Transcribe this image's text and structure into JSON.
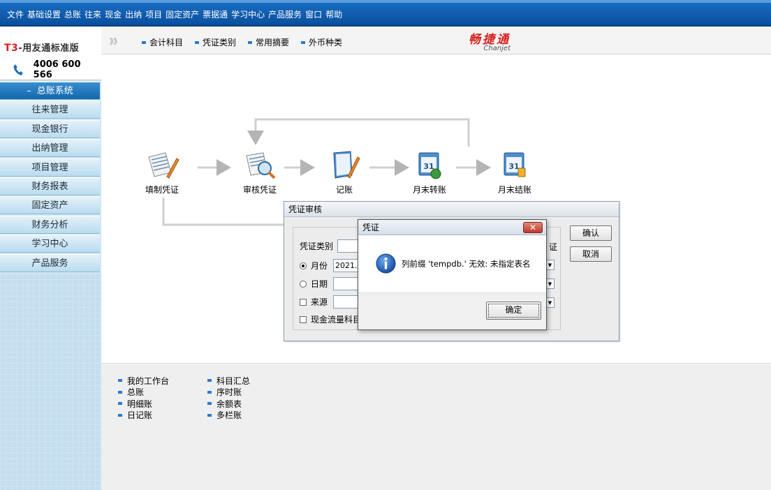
{
  "menu": [
    "文件",
    "基础设置",
    "总账",
    "往来",
    "现金",
    "出纳",
    "项目",
    "固定资产",
    "票据通",
    "学习中心",
    "产品服务",
    "窗口",
    "帮助"
  ],
  "brand": {
    "product_prefix": "T3",
    "product_name": "-用友通标准版",
    "phone": "4006 600 566",
    "accent": "#d8201c"
  },
  "sidebar": {
    "items": [
      {
        "label": "总账系统",
        "active": true
      },
      {
        "label": "往来管理"
      },
      {
        "label": "现金银行"
      },
      {
        "label": "出纳管理"
      },
      {
        "label": "项目管理"
      },
      {
        "label": "财务报表"
      },
      {
        "label": "固定资产"
      },
      {
        "label": "财务分析"
      },
      {
        "label": "学习中心"
      },
      {
        "label": "产品服务"
      }
    ]
  },
  "toolbar": {
    "chevron": "》》",
    "links": [
      "会计科目",
      "凭证类别",
      "常用摘要",
      "外币种类"
    ],
    "logo_cn": "畅捷通",
    "logo_en": "Chanjet"
  },
  "workflow": {
    "steps": [
      "填制凭证",
      "审核凭证",
      "记账",
      "月末转账",
      "月末结账"
    ]
  },
  "quicklinks": {
    "col1": [
      "我的工作台",
      "总账",
      "明细账",
      "日记账"
    ],
    "col2": [
      "科目汇总",
      "序时账",
      "余额表",
      "多栏账"
    ]
  },
  "audit_dialog": {
    "title": "凭证审核",
    "voucher_type_label": "凭证类别",
    "month_label": "月份",
    "month_value": "2021.0",
    "date_label": "日期",
    "source_label": "来源",
    "cashflow_label": "现金流量科目",
    "right_edge_text": "证",
    "confirm_label": "确认",
    "cancel_label": "取消",
    "dropdown_arrow": "▼"
  },
  "message_box": {
    "title": "凭证",
    "close_glyph": "✕",
    "message": "列前缀 'tempdb.' 无效: 未指定表名",
    "ok_label": "确定"
  }
}
